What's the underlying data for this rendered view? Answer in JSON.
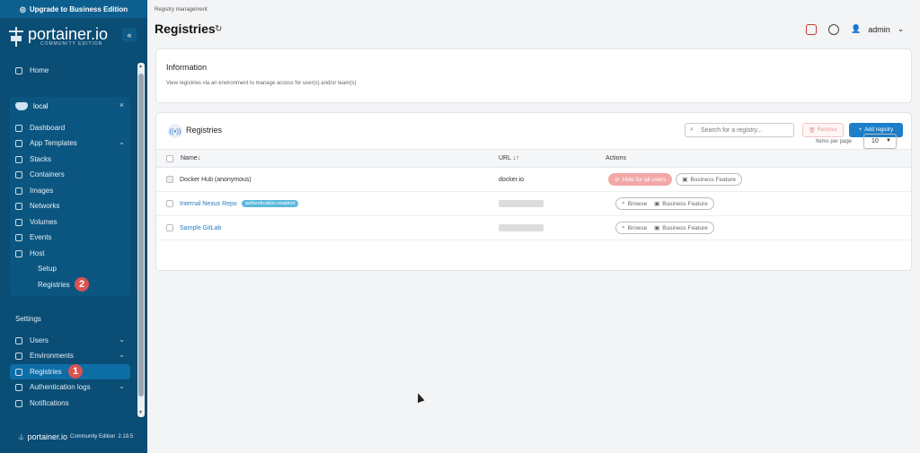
{
  "sidebar": {
    "upgrade_label": "Upgrade to Business Edition",
    "brand_name": "portainer.io",
    "brand_edition": "COMMUNITY EDITION",
    "collapse_label": "«",
    "home_label": "Home",
    "env": {
      "name": "local",
      "close_label": "×"
    },
    "env_items": [
      {
        "label": "Dashboard"
      },
      {
        "label": "App Templates"
      },
      {
        "label": "Stacks"
      },
      {
        "label": "Containers"
      },
      {
        "label": "Images"
      },
      {
        "label": "Networks"
      },
      {
        "label": "Volumes"
      },
      {
        "label": "Events"
      },
      {
        "label": "Host"
      }
    ],
    "host_subitems": [
      {
        "label": "Setup"
      },
      {
        "label": "Registries"
      }
    ],
    "settings_label": "Settings",
    "settings_items": [
      {
        "label": "Users"
      },
      {
        "label": "Environments"
      },
      {
        "label": "Registries"
      },
      {
        "label": "Authentication logs"
      },
      {
        "label": "Notifications"
      }
    ],
    "badge_1": "1",
    "badge_2": "2",
    "footer_brand": "portainer.io",
    "footer_edition": "Community Edition",
    "footer_version": "2.19.5"
  },
  "header": {
    "breadcrumb": "Registry management",
    "title": "Registries",
    "user_name": "admin"
  },
  "info": {
    "title": "Information",
    "text": "View registries via an environment to manage access for user(s) and/or team(s)"
  },
  "registries": {
    "title": "Registries",
    "search_placeholder": "Search for a registry...",
    "remove_label": "Remove",
    "add_label": "Add registry",
    "columns": {
      "name": "Name↓",
      "url": "URL ↓↑",
      "actions": "Actions"
    },
    "rows": [
      {
        "name": "Docker Hub (anonymous)",
        "url": "docker.io"
      },
      {
        "name": "Internal Nexus Repo",
        "tag": "authentication-enabled"
      },
      {
        "name": "Sample GitLab"
      }
    ],
    "hide_for_all_users": "Hide for all users",
    "business_feature": "Business Feature",
    "browse_label": "Browse",
    "items_per_page_label": "Items per page",
    "items_per_page_value": "10"
  },
  "colors": {
    "sidebar_bg": "#0a4d75",
    "accent": "#1d7fc9",
    "badge": "#d9534f"
  }
}
